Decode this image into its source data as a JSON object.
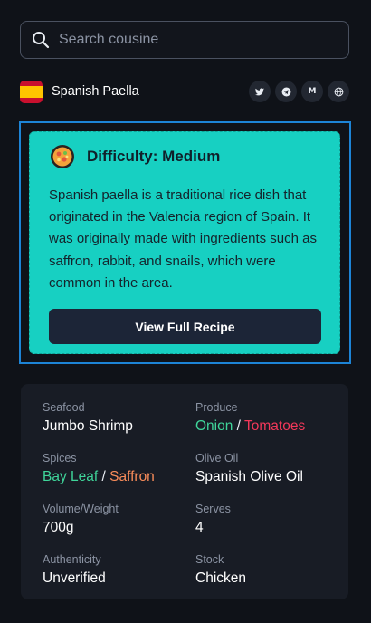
{
  "search": {
    "placeholder": "Search cousine"
  },
  "dish": {
    "name": "Spanish Paella",
    "flag": "spain-flag"
  },
  "socials": [
    {
      "icon": "twitter-icon",
      "glyph": "𝕥"
    },
    {
      "icon": "telegram-icon",
      "glyph": "➤"
    },
    {
      "icon": "medium-icon",
      "glyph": "M"
    },
    {
      "icon": "globe-icon",
      "glyph": "◍"
    }
  ],
  "card": {
    "difficulty": "Difficulty: Medium",
    "description": "Spanish paella is a traditional rice dish that originated in the Valencia region of Spain. It was originally made with ingredients such as saffron, rabbit, and snails, which were common in the area.",
    "button": "View Full Recipe",
    "bg_color": "#17d0c2"
  },
  "details": {
    "seafood": {
      "label": "Seafood",
      "value": "Jumbo Shrimp"
    },
    "produce": {
      "label": "Produce",
      "value_a": "Onion",
      "sep": " / ",
      "value_b": "Tomatoes"
    },
    "spices": {
      "label": "Spices",
      "value_a": "Bay Leaf",
      "sep": " / ",
      "value_b": "Saffron"
    },
    "olive_oil": {
      "label": "Olive Oil",
      "value": "Spanish Olive Oil"
    },
    "volume": {
      "label": "Volume/Weight",
      "value": "700g"
    },
    "serves": {
      "label": "Serves",
      "value": "4"
    },
    "authenticity": {
      "label": "Authenticity",
      "value": "Unverified"
    },
    "stock": {
      "label": "Stock",
      "value": "Chicken"
    }
  },
  "colors": {
    "accent_green": "#3fd59a",
    "accent_red": "#f2385a",
    "accent_orange": "#f98c5a",
    "selection_border": "#1d84d6"
  }
}
